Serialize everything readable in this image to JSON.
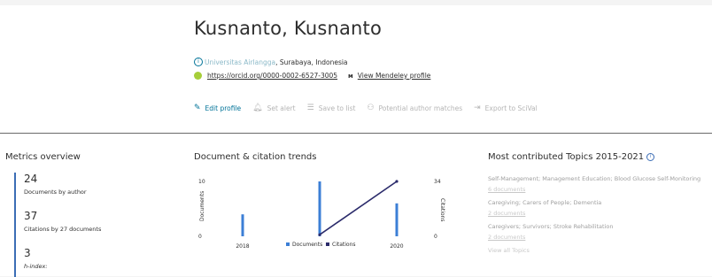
{
  "author": {
    "name": "Kusnanto, Kusnanto",
    "affiliation_org": "Universitas Airlangga",
    "affiliation_location": ", Surabaya, Indonesia",
    "orcid_url": "https://orcid.org/0000-0002-6527-3005",
    "mendeley_link": "View Mendeley profile"
  },
  "toolbar": {
    "edit_profile": "Edit profile",
    "set_alert": "Set alert",
    "save_to_list": "Save to list",
    "potential_matches": "Potential author matches",
    "export_scival": "Export to SciVal"
  },
  "metrics": {
    "title": "Metrics overview",
    "documents_value": "24",
    "documents_label": "Documents by author",
    "citations_value": "37",
    "citations_label": "Citations by 27 documents",
    "hindex_value": "3",
    "hindex_label": "h-index:"
  },
  "trends": {
    "title": "Document & citation trends"
  },
  "chart_data": {
    "type": "bar",
    "x": [
      "2018",
      "2019",
      "2020"
    ],
    "x_tick_labels": [
      "2018",
      "",
      "2020"
    ],
    "series": [
      {
        "name": "Documents",
        "type": "bar",
        "values": [
          4,
          10,
          6
        ]
      },
      {
        "name": "Citations",
        "type": "line",
        "values": [
          0,
          1,
          34
        ]
      }
    ],
    "ylabel_left": "Documents",
    "ylabel_right": "Citations",
    "ylim_left": [
      0,
      10
    ],
    "ylim_right": [
      0,
      34
    ],
    "left_ticks": [
      "10",
      "0"
    ],
    "right_ticks": [
      "34",
      "0"
    ],
    "legend": "bottom",
    "colors": {
      "documents": "#3c7fd6",
      "citations": "#2b2b6b"
    }
  },
  "topics": {
    "title": "Most contributed Topics 2015-2021",
    "items": [
      {
        "title": "Self-Management; Management Education; Blood Glucose Self-Monitoring",
        "docs": "6 documents"
      },
      {
        "title": "Caregiving; Carers of People; Dementia",
        "docs": "2 documents"
      },
      {
        "title": "Caregivers; Survivors; Stroke Rehabilitation",
        "docs": "2 documents"
      }
    ],
    "view_all": "View all Topics"
  }
}
